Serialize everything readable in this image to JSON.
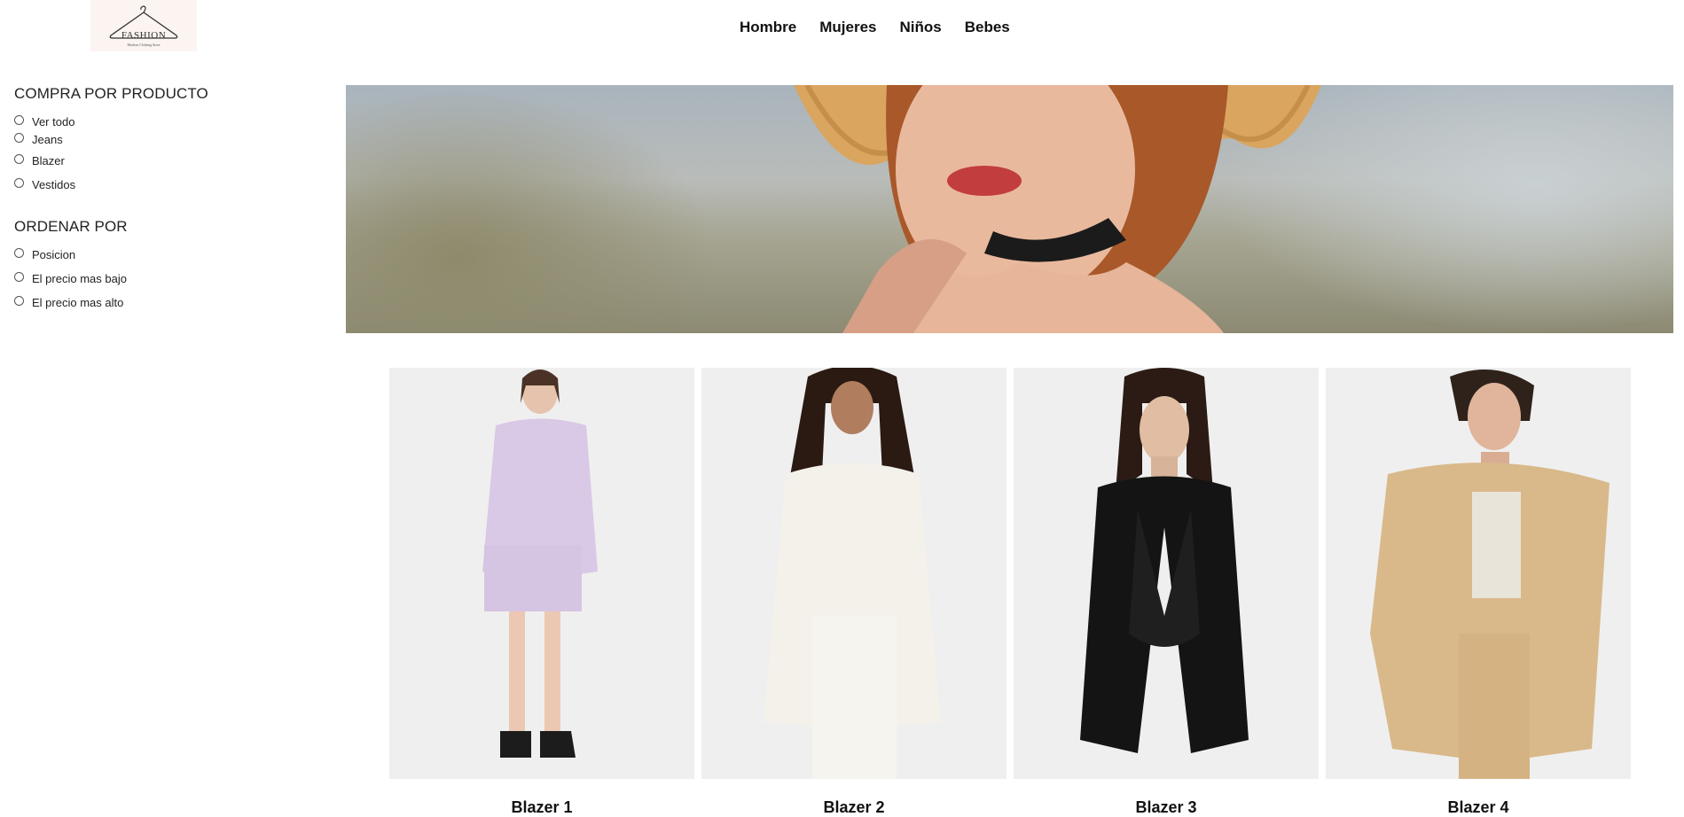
{
  "logo": {
    "brand": "FASHION",
    "tagline": "Modern Clothing Store"
  },
  "nav": {
    "items": [
      "Hombre",
      "Mujeres",
      "Niños",
      "Bebes"
    ]
  },
  "sidebar": {
    "shop_by_product": {
      "title": "COMPRA POR PRODUCTO",
      "options": [
        "Ver todo",
        "Jeans",
        "Blazer",
        "Vestidos"
      ]
    },
    "sort_by": {
      "title": "ORDENAR POR",
      "options": [
        "Posicion",
        "El precio mas bajo",
        "El precio mas alto"
      ]
    }
  },
  "banner": {
    "subject": "woman with straw hat"
  },
  "products": [
    {
      "name": "Blazer 1",
      "color": "#d9c8e6"
    },
    {
      "name": "Blazer 2",
      "color": "#f3f1ea"
    },
    {
      "name": "Blazer 3",
      "color": "#141414"
    },
    {
      "name": "Blazer 4",
      "color": "#d9b98a"
    }
  ]
}
